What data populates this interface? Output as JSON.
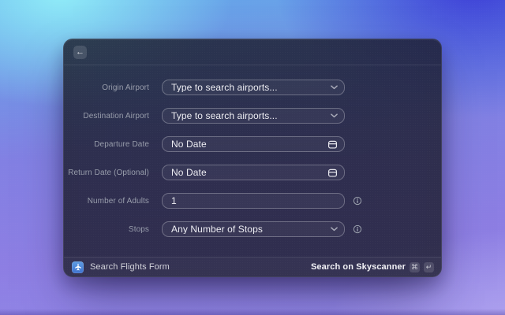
{
  "window": {
    "header": {
      "back_icon": "←"
    },
    "form": {
      "rows": [
        {
          "label": "Origin Airport",
          "value": "Type to search airports...",
          "type": "select",
          "info": false
        },
        {
          "label": "Destination Airport",
          "value": "Type to search airports...",
          "type": "select",
          "info": false
        },
        {
          "label": "Departure Date",
          "value": "No Date",
          "type": "date",
          "info": false
        },
        {
          "label": "Return Date (Optional)",
          "value": "No Date",
          "type": "date",
          "info": false
        },
        {
          "label": "Number of Adults",
          "value": "1",
          "type": "text",
          "info": true
        },
        {
          "label": "Stops",
          "value": "Any Number of Stops",
          "type": "select",
          "info": true
        }
      ]
    },
    "footer": {
      "title": "Search Flights Form",
      "action_label": "Search on Skyscanner",
      "shortcut_keys": [
        "⌘",
        "↵"
      ]
    }
  },
  "colors": {
    "extension_icon_blue": "#4a87d8",
    "wallpaper_cyan": "#90ecf8",
    "wallpaper_blue": "#3b3ad6",
    "wallpaper_purple": "#8d7ee3"
  }
}
